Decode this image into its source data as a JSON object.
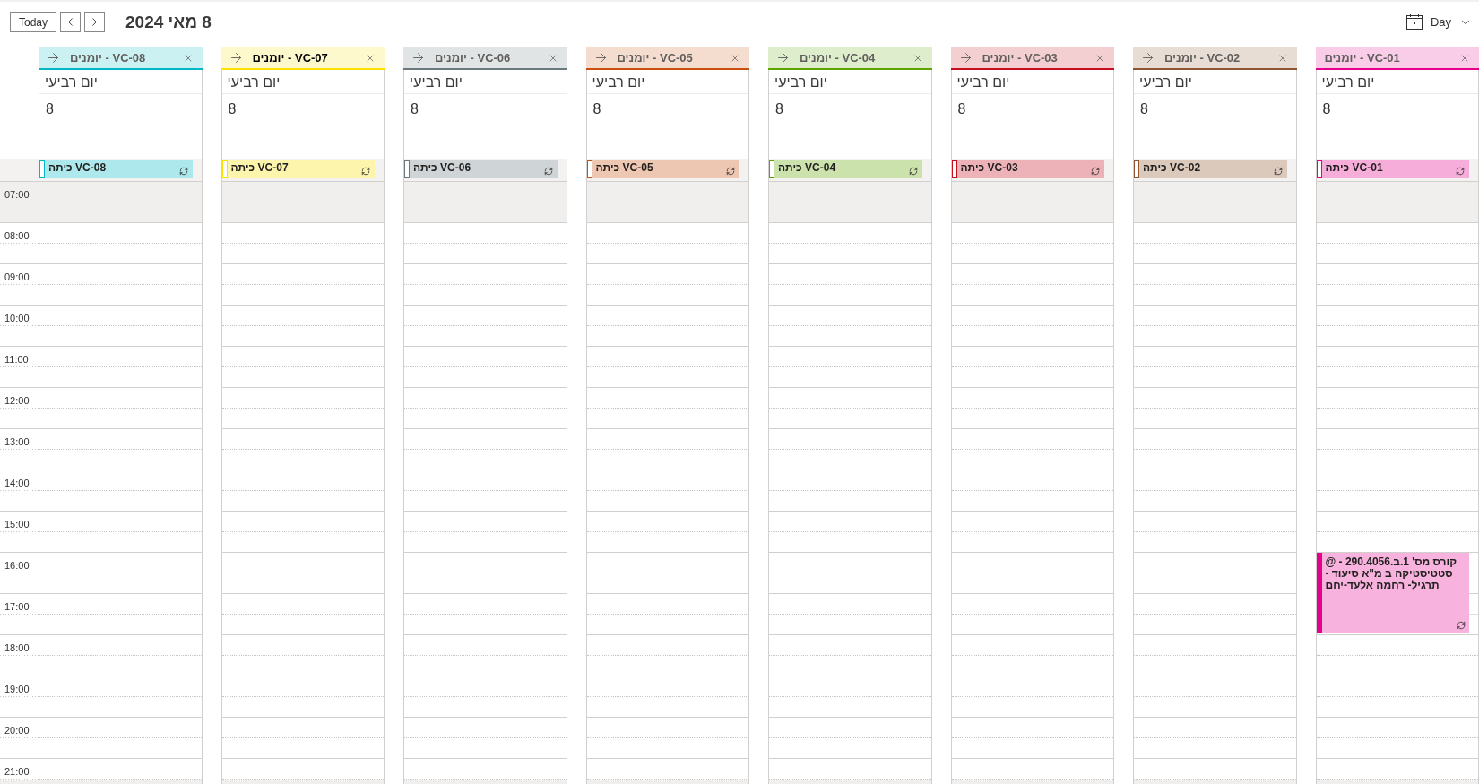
{
  "toolbar": {
    "today_button": "Today",
    "title": "8 מאי 2024",
    "view_button": "Day"
  },
  "time_gutter": {
    "hours": [
      {
        "label": "07:00",
        "first_half_off": true,
        "second_half_off": true
      },
      {
        "label": "08:00",
        "first_half_off": false,
        "second_half_off": false
      },
      {
        "label": "09:00",
        "first_half_off": false,
        "second_half_off": false
      },
      {
        "label": "10:00",
        "first_half_off": false,
        "second_half_off": false
      },
      {
        "label": "11:00",
        "first_half_off": false,
        "second_half_off": false
      },
      {
        "label": "12:00",
        "first_half_off": false,
        "second_half_off": false
      },
      {
        "label": "13:00",
        "first_half_off": false,
        "second_half_off": false
      },
      {
        "label": "14:00",
        "first_half_off": false,
        "second_half_off": false
      },
      {
        "label": "15:00",
        "first_half_off": false,
        "second_half_off": false
      },
      {
        "label": "16:00",
        "first_half_off": false,
        "second_half_off": false
      },
      {
        "label": "17:00",
        "first_half_off": false,
        "second_half_off": false
      },
      {
        "label": "18:00",
        "first_half_off": false,
        "second_half_off": false
      },
      {
        "label": "19:00",
        "first_half_off": false,
        "second_half_off": false
      },
      {
        "label": "20:00",
        "first_half_off": false,
        "second_half_off": false
      },
      {
        "label": "21:00",
        "first_half_off": false,
        "second_half_off": true
      }
    ]
  },
  "calendars": [
    {
      "name": "יומנים - VC-01",
      "color": "#e3008c",
      "selected": false,
      "movable": false,
      "day_name": "יום רביעי",
      "date": "8",
      "all_day_events": [
        {
          "title": "כיתה VC-01",
          "recurring": true,
          "free": true
        }
      ],
      "hours": [
        {
          "busy": false
        },
        {
          "busy": false
        },
        {
          "busy": false
        },
        {
          "busy": false
        },
        {
          "busy": false
        },
        {
          "busy": false
        },
        {
          "busy": false
        },
        {
          "busy": false
        },
        {
          "busy": false
        },
        {
          "busy": true,
          "event": {
            "title": "קורס מס' 1.ב.290.4056 - @ סטטיסטיקה ב מ\"א סיעוד - תרגיל- רחמה אלעד-יחם",
            "recurring": true,
            "free": false
          }
        },
        {
          "busy": true
        },
        {
          "busy": false
        },
        {
          "busy": false
        },
        {
          "busy": false
        },
        {
          "busy": false
        }
      ]
    },
    {
      "name": "יומנים - VC-02",
      "color": "#8e562e",
      "selected": false,
      "movable": true,
      "day_name": "יום רביעי",
      "date": "8",
      "all_day_events": [
        {
          "title": "כיתה VC-02",
          "recurring": true,
          "free": true
        }
      ]
    },
    {
      "name": "יומנים - VC-03",
      "color": "#c50f1f",
      "selected": false,
      "movable": true,
      "day_name": "יום רביעי",
      "date": "8",
      "all_day_events": [
        {
          "title": "כיתה VC-03",
          "recurring": true,
          "free": true
        }
      ]
    },
    {
      "name": "יומנים - VC-04",
      "color": "#5ca300",
      "selected": false,
      "movable": true,
      "day_name": "יום רביעי",
      "date": "8",
      "all_day_events": [
        {
          "title": "כיתה VC-04",
          "recurring": true,
          "free": true
        }
      ]
    },
    {
      "name": "יומנים - VC-05",
      "color": "#ca5010",
      "selected": false,
      "movable": true,
      "day_name": "יום רביעי",
      "date": "8",
      "all_day_events": [
        {
          "title": "כיתה VC-05",
          "recurring": true,
          "free": true
        }
      ]
    },
    {
      "name": "יומנים - VC-06",
      "color": "#69797e",
      "selected": false,
      "movable": true,
      "day_name": "יום רביעי",
      "date": "8",
      "all_day_events": [
        {
          "title": "כיתה VC-06",
          "recurring": true,
          "free": true
        }
      ]
    },
    {
      "name": "יומנים - VC-07",
      "color": "#fce100",
      "selected": true,
      "movable": true,
      "day_name": "יום רביעי",
      "date": "8",
      "all_day_events": [
        {
          "title": "כיתה VC-07",
          "recurring": true,
          "free": true
        }
      ]
    },
    {
      "name": "יומנים - VC-08",
      "color": "#00b7c3",
      "selected": false,
      "movable": true,
      "day_name": "יום רביעי",
      "date": "8",
      "all_day_events": [
        {
          "title": "כיתה VC-08",
          "recurring": true,
          "free": true
        }
      ]
    }
  ]
}
